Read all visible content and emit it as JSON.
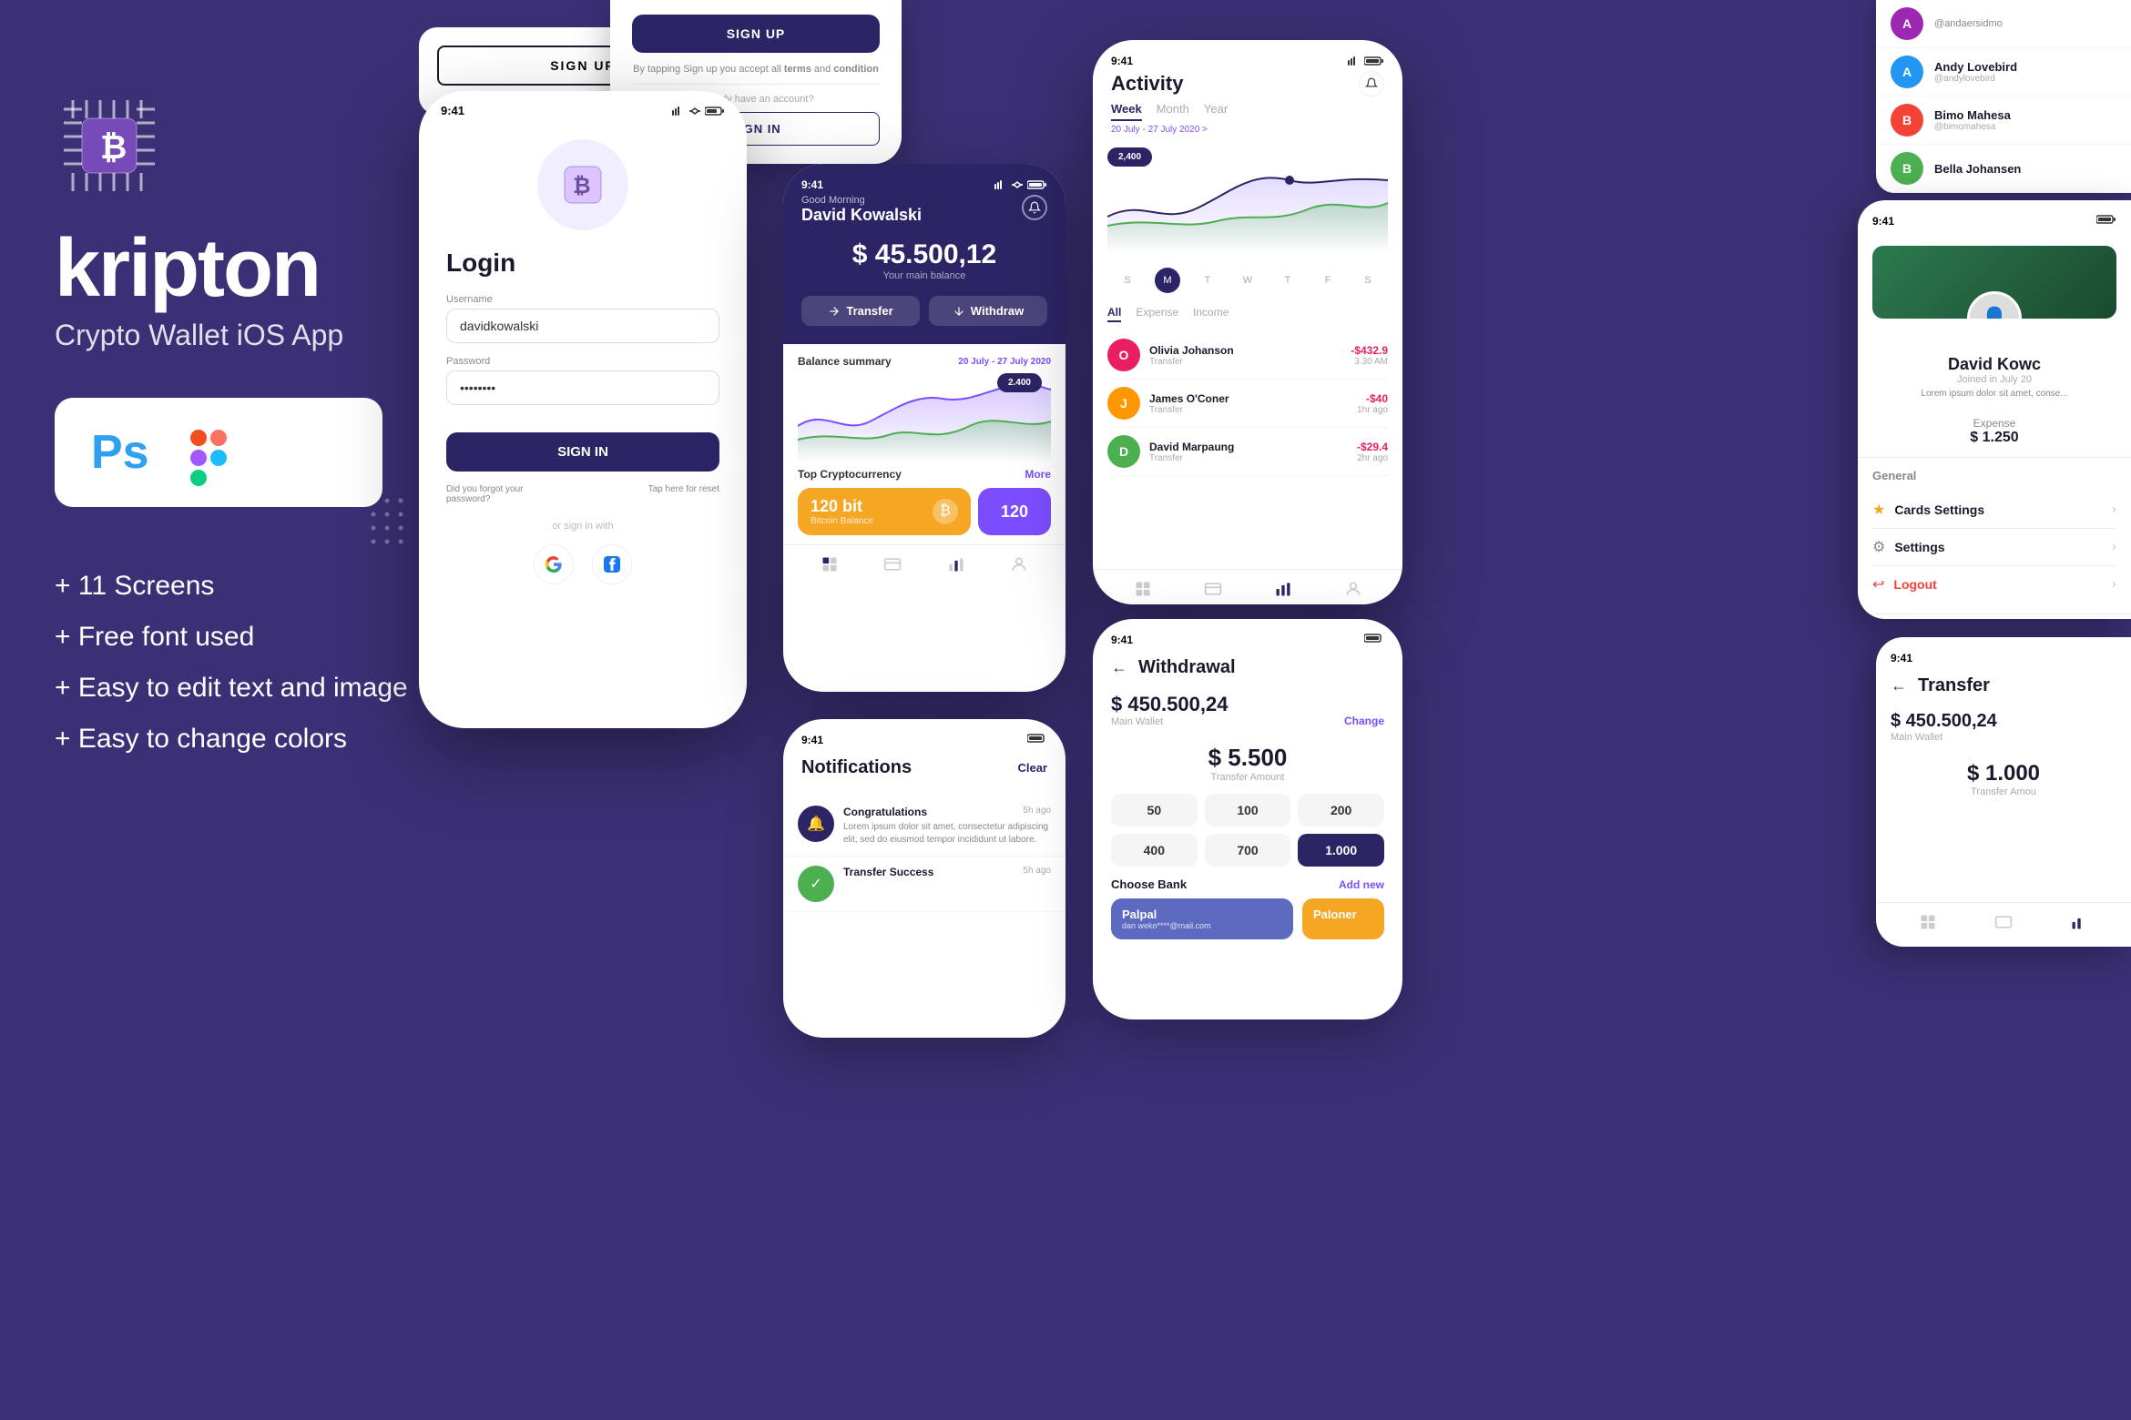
{
  "app": {
    "name": "kripton",
    "subtitle": "Crypto Wallet iOS App",
    "features": [
      "+ 11 Screens",
      "+ Free font used",
      "+ Easy to edit text and image",
      "+ Easy to change colors"
    ]
  },
  "login_screen": {
    "time": "9:41",
    "title": "Login",
    "username_label": "Username",
    "username_value": "davidkowalski",
    "password_label": "Password",
    "password_value": "••••••••",
    "signin_btn": "SIGN IN",
    "forgot": "Did you forgot your password?",
    "reset": "Tap here for reset",
    "or_signin": "or sign in with"
  },
  "signup_screen": {
    "signup_btn": "SIGN UP",
    "desc": "By tapping Sign up you accept all terms and condition",
    "have_account": "Already have an account?",
    "signin_link": "SIGN IN"
  },
  "dashboard_screen": {
    "time": "9:41",
    "greeting": "Good Morning",
    "username": "David Kowalski",
    "balance": "$ 45.500,12",
    "balance_label": "Your main balance",
    "transfer_btn": "Transfer",
    "withdraw_btn": "Withdraw",
    "balance_summary_label": "Balance summary",
    "date_range": "20 July - 27 July 2020",
    "chart_value": "2.400",
    "top_crypto_label": "Top Cryptocurrency",
    "more_link": "More",
    "crypto_name": "120 bit",
    "crypto_label": "Bitcoin Balance",
    "crypto_value": "120"
  },
  "activity_screen": {
    "time": "9:41",
    "title": "Activity",
    "tab_week": "Week",
    "tab_month": "Month",
    "tab_year": "Year",
    "date_range": "20 July - 27 July 2020",
    "chart_value": "2,400",
    "days": [
      "S",
      "M",
      "T",
      "W",
      "T",
      "F",
      "S"
    ],
    "active_day": "M",
    "filter_all": "All",
    "filter_expense": "Expense",
    "filter_income": "Income",
    "transactions": [
      {
        "name": "Olivia Johanson",
        "type": "Transfer",
        "amount": "-$432.9",
        "time": "3.30 AM",
        "color": "#e91e63"
      },
      {
        "name": "James O'Coner",
        "type": "Transfer",
        "amount": "-$40",
        "time": "1hr ago",
        "color": "#ff9800"
      },
      {
        "name": "David Marpaung",
        "type": "Transfer",
        "amount": "-$29.4",
        "time": "2hr ago",
        "color": "#4caf50"
      }
    ]
  },
  "profile_sidebar": {
    "users": [
      {
        "name": "@andaersidmo",
        "avatar_color": "#9c27b0"
      },
      {
        "name": "Andy Lovebird",
        "handle": "@andylovebird",
        "avatar_color": "#2196f3"
      },
      {
        "name": "Bimo Mahesa",
        "handle": "@bimomahesa",
        "avatar_color": "#f44336"
      },
      {
        "name": "Bella Johansen",
        "avatar_color": "#4caf50"
      }
    ]
  },
  "withdrawal_screen": {
    "time": "9:41",
    "title": "Withdrawal",
    "back": "←",
    "wallet_amount": "$ 450.500,24",
    "wallet_label": "Main Wallet",
    "change_btn": "Change",
    "transfer_amount": "$ 5.500",
    "transfer_label": "Transfer Amount",
    "amounts": [
      "50",
      "100",
      "200",
      "400",
      "700",
      "1.000"
    ],
    "selected_amount": "1.000",
    "choose_bank": "Choose Bank",
    "add_new": "Add new",
    "bank1": "Palpal",
    "bank1_account": "dan weko****@mail.com",
    "bank2": "Paloner"
  },
  "notifications_screen": {
    "time": "9:41",
    "title": "Notifications",
    "clear_btn": "Clear",
    "notifications": [
      {
        "title": "Congratulations",
        "time": "5h ago",
        "desc": "Lorem ipsum dolor sit amet, consectetur adipiscing elit, sed do eiusmod tempor incididunt ut labore.",
        "icon": "🔔"
      },
      {
        "title": "Transfer Success",
        "time": "5h ago",
        "icon": "✓"
      }
    ]
  },
  "profile_screen": {
    "time": "9:41",
    "name": "David Kowc",
    "joined": "Joined in July 20",
    "desc": "Lorem ipsum dolor sit amet, conse...",
    "expense_label": "Expense",
    "expense_value": "$ 1.250",
    "general_label": "General",
    "menu_items": [
      {
        "label": "Cards Settings",
        "icon": "★"
      },
      {
        "label": "Settings",
        "icon": "⚙"
      },
      {
        "label": "Logout",
        "icon": "→",
        "color": "#f44336"
      }
    ]
  },
  "transfer_screen": {
    "time": "9:41",
    "title": "Transfer",
    "back": "←",
    "wallet_amount": "$ 450.500,24",
    "wallet_label": "Main Wallet",
    "transfer_amount": "$ 1.000",
    "transfer_label": "Transfer Amou"
  },
  "colors": {
    "primary": "#2c2565",
    "background": "#3b3075",
    "accent": "#7c4dff",
    "orange": "#f5a623",
    "white": "#ffffff"
  }
}
